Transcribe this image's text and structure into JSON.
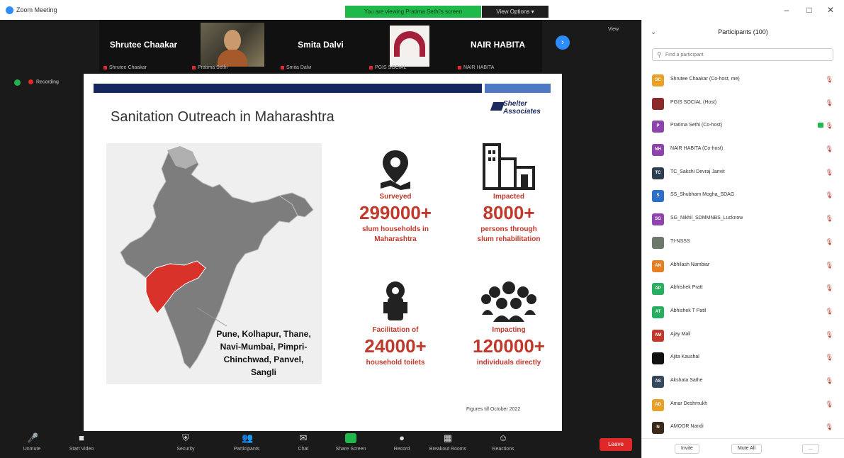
{
  "window": {
    "title": "Zoom Meeting",
    "share_banner": "You are viewing Pratima Sethi's screen",
    "view_options": "View Options ▾",
    "minimize": "–",
    "maximize": "□",
    "close": "✕"
  },
  "gallery": {
    "tiles": [
      {
        "name": "Shrutee Chaakar",
        "sub": "Shrutee Chaakar"
      },
      {
        "name": "",
        "sub": "Pratima Sethi"
      },
      {
        "name": "Smita Dalvi",
        "sub": "Smita Dalvi"
      },
      {
        "name": "",
        "sub": "PGIS SOCIAL"
      },
      {
        "name": "NAIR HABITA",
        "sub": "NAIR HABITA"
      }
    ],
    "next_label": "›",
    "view_label": "View"
  },
  "status": {
    "recording": "Recording"
  },
  "slide": {
    "title": "Sanitation Outreach in Maharashtra",
    "logo": "Shelter Associates",
    "cities": [
      "Pune, Kolhapur, Thane,",
      "Navi-Mumbai, Pimpri-",
      "Chinchwad, Panvel,",
      "Sangli"
    ],
    "stats": [
      {
        "label": "Surveyed",
        "value": "299000+",
        "desc": [
          "slum households in",
          "Maharashtra"
        ],
        "icon": "map-pin-icon"
      },
      {
        "label": "Impacted",
        "value": "8000+",
        "desc": [
          "persons through",
          "slum rehabilitation"
        ],
        "icon": "buildings-icon"
      },
      {
        "label": "Facilitation of",
        "value": "24000+",
        "desc": [
          "household toilets"
        ],
        "icon": "toilet-icon"
      },
      {
        "label": "Impacting",
        "value": "120000+",
        "desc": [
          "individuals directly"
        ],
        "icon": "people-icon"
      }
    ],
    "figures_note": "Figures till October 2022"
  },
  "toolbar": {
    "items": [
      {
        "label": "Unmute",
        "icon": "🎤"
      },
      {
        "label": "Start Video",
        "icon": "■"
      },
      {
        "label": "Security",
        "icon": "⛨"
      },
      {
        "label": "Participants",
        "icon": "👥"
      },
      {
        "label": "Chat",
        "icon": "✉"
      },
      {
        "label": "Share Screen",
        "icon": ""
      },
      {
        "label": "Record",
        "icon": "●"
      },
      {
        "label": "Breakout Rooms",
        "icon": "▦"
      },
      {
        "label": "Reactions",
        "icon": "☺"
      }
    ],
    "participants_count": "100",
    "end_label": "Leave"
  },
  "panel": {
    "title": "Participants (100)",
    "collapse": "⌄",
    "search_placeholder": "Find a participant",
    "participants": [
      {
        "name": "Shrutee Chaakar (Co-host, me)",
        "initials": "SC",
        "color": "#e8a02a",
        "video": false
      },
      {
        "name": "PGIS SOCIAL (Host)",
        "initials": "",
        "color": "#8a2a2a",
        "video": false
      },
      {
        "name": "Pratima Sethi (Co-host)",
        "initials": "P",
        "color": "#8e44ad",
        "video": true
      },
      {
        "name": "NAIR HABITA (Co-host)",
        "initials": "NH",
        "color": "#8e44ad",
        "video": false
      },
      {
        "name": "TC_Sakshi Devraj Janvit",
        "initials": "TC",
        "color": "#2c3e50",
        "video": false
      },
      {
        "name": "SS_Shubham Mogha_SDAG",
        "initials": "S",
        "color": "#2c6fc9",
        "video": false
      },
      {
        "name": "SG_Nikhil_SDMMNBS_Lucknow",
        "initials": "SG",
        "color": "#8e44ad",
        "video": false
      },
      {
        "name": "TI-NSSS",
        "initials": "",
        "color": "#6c7a6c",
        "video": false
      },
      {
        "name": "Abhilash Nambiar",
        "initials": "AN",
        "color": "#e67e22",
        "video": false
      },
      {
        "name": "Abhishek Pratt",
        "initials": "AP",
        "color": "#27ae60",
        "video": false
      },
      {
        "name": "Abhishek T Patil",
        "initials": "AT",
        "color": "#27ae60",
        "video": false
      },
      {
        "name": "Ajay Mali",
        "initials": "AM",
        "color": "#c0392b",
        "video": false
      },
      {
        "name": "Ajita Kaushal",
        "initials": "",
        "color": "#111111",
        "video": false
      },
      {
        "name": "Akshata Sathe",
        "initials": "AS",
        "color": "#34495e",
        "video": false
      },
      {
        "name": "Amar Deshmukh",
        "initials": "AD",
        "color": "#e8a02a",
        "video": false
      },
      {
        "name": "AMOOR Nandi",
        "initials": "N",
        "color": "#3b2a1a",
        "video": false
      }
    ],
    "invite_label": "Invite",
    "unmute_all_label": "Mute All",
    "more_label": "..."
  },
  "colors": {
    "zoom_blue": "#2d8cff",
    "share_green": "#1fb84a",
    "slide_red": "#c0392b",
    "maharashtra_red": "#d8322a",
    "navy_bar": "#16265e"
  }
}
